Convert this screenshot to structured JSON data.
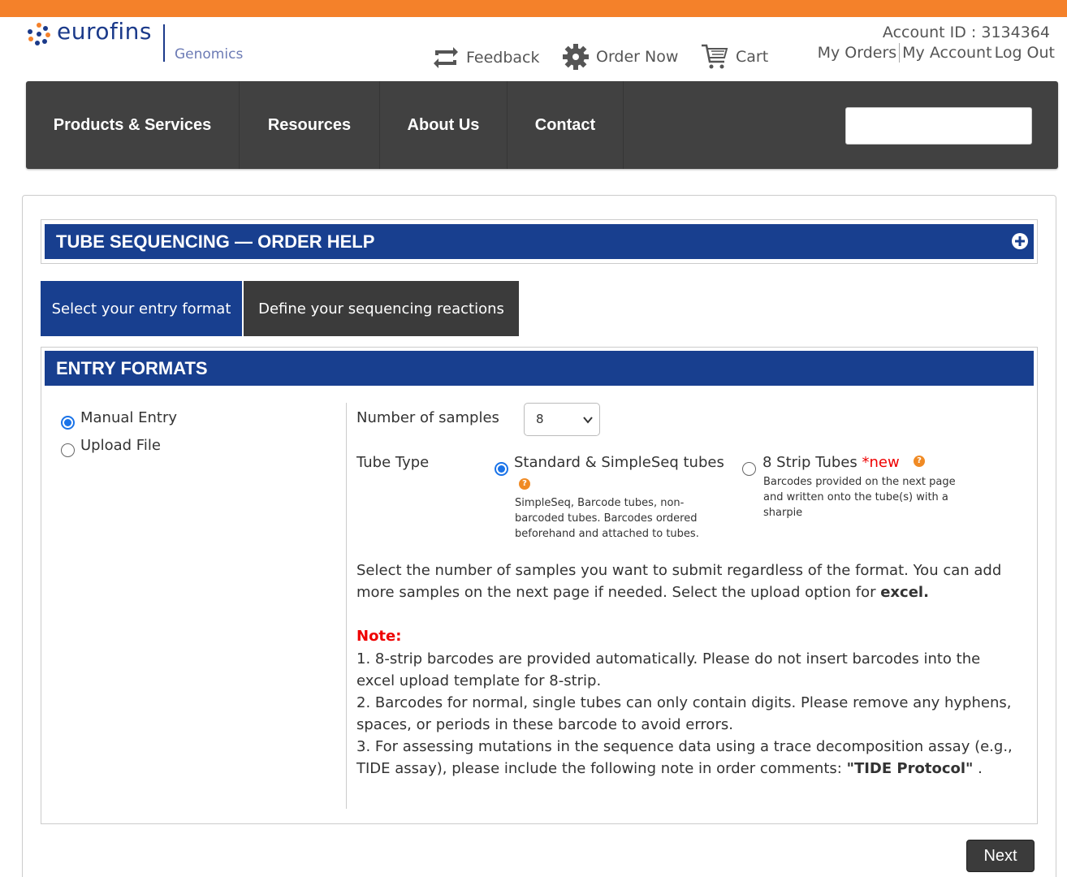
{
  "brand": {
    "name": "eurofins",
    "division": "Genomics"
  },
  "header": {
    "feedback": "Feedback",
    "order_now": "Order Now",
    "cart": "Cart",
    "account_id": "Account ID : 3134364",
    "my_orders": "My Orders",
    "my_account": "My Account",
    "log_out": "Log Out"
  },
  "nav": {
    "items": [
      "Products & Services",
      "Resources",
      "About Us",
      "Contact"
    ],
    "search_placeholder": ""
  },
  "help": {
    "title": "TUBE SEQUENCING — ORDER HELP"
  },
  "tabs": [
    {
      "label": "Select your entry format"
    },
    {
      "label": "Define your sequencing reactions"
    }
  ],
  "entry": {
    "title": "ENTRY FORMATS",
    "options": [
      {
        "label": "Manual Entry",
        "checked": true
      },
      {
        "label": "Upload File",
        "checked": false
      }
    ],
    "samples_label": "Number of samples",
    "samples_value": "8",
    "tube_type_label": "Tube Type",
    "tube_standard": "Standard & SimpleSeq tubes",
    "tube_standard_desc": "SimpleSeq, Barcode tubes, non-barcoded tubes. Barcodes ordered beforehand and attached to tubes.",
    "tube_strip": "8 Strip Tubes",
    "tube_strip_new": "*new",
    "tube_strip_desc": "Barcodes provided on the next page and written onto the tube(s) with a sharpie",
    "instructions_main": "Select the number of samples you want to submit regardless of the format. You can add more samples on the next page if needed. Select the upload option for",
    "instructions_bold": "excel.",
    "note_title": "Note:",
    "note_1": "1. 8-strip barcodes are provided automatically. Please do not insert barcodes into the excel upload template for 8-strip.",
    "note_2": "2. Barcodes for normal, single tubes can only contain digits. Please remove any hyphens, spaces, or periods in these barcode to avoid errors.",
    "note_3_main": "3. For assessing mutations in the sequence data using a trace decomposition assay (e.g., TIDE assay), please include the following note in order comments:",
    "note_3_bold": "\"TIDE Protocol\"",
    "note_3_end": " ."
  },
  "actions": {
    "next": "Next"
  },
  "colors": {
    "accent_orange": "#f4812a",
    "brand_blue": "#183f8f",
    "nav_gray": "#414141"
  }
}
